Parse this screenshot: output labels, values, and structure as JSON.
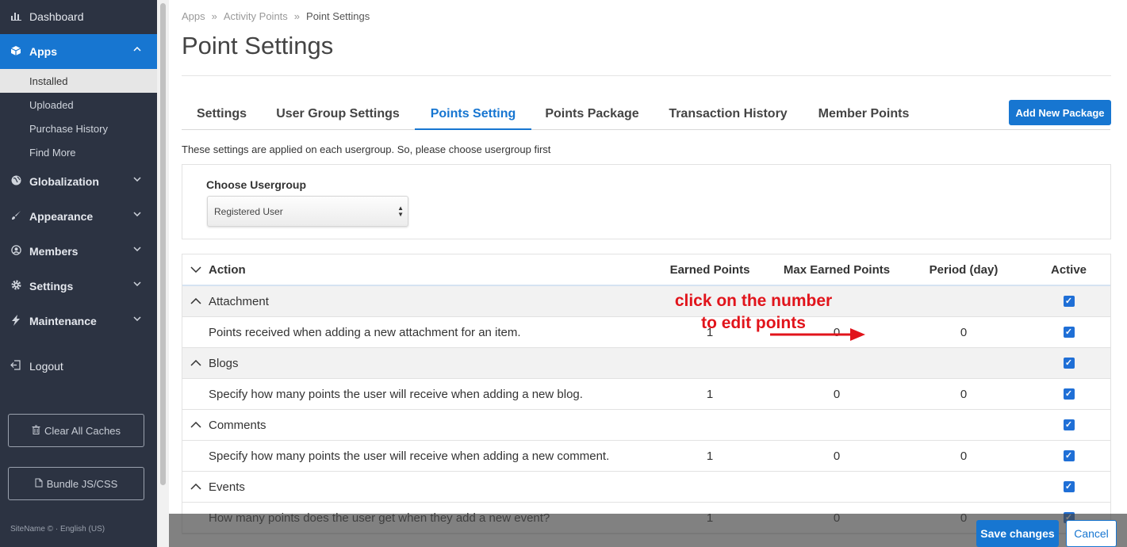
{
  "sidebar": {
    "items": [
      {
        "label": "Dashboard",
        "icon": "bar-chart-icon"
      },
      {
        "label": "Apps",
        "icon": "cube-icon"
      },
      {
        "label": "Globalization",
        "icon": "globe-icon"
      },
      {
        "label": "Appearance",
        "icon": "brush-icon"
      },
      {
        "label": "Members",
        "icon": "user-circle-icon"
      },
      {
        "label": "Settings",
        "icon": "gear-icon"
      },
      {
        "label": "Maintenance",
        "icon": "bolt-icon"
      },
      {
        "label": "Logout",
        "icon": "logout-icon"
      }
    ],
    "apps_subitems": [
      "Installed",
      "Uploaded",
      "Purchase History",
      "Find More"
    ],
    "clear_cache_label": "Clear All Caches",
    "bundle_label": "Bundle JS/CSS",
    "footer": "SiteName © · English (US)"
  },
  "breadcrumb": [
    "Apps",
    "Activity Points",
    "Point Settings"
  ],
  "page_title": "Point Settings",
  "tabs": [
    "Settings",
    "User Group Settings",
    "Points Setting",
    "Points Package",
    "Transaction History",
    "Member Points"
  ],
  "active_tab": "Points Setting",
  "add_button_label": "Add New Package",
  "description": "These settings are applied on each usergroup. So, please choose usergroup first",
  "usergroup": {
    "label": "Choose Usergroup",
    "selected": "Registered User"
  },
  "table": {
    "headers": {
      "action": "Action",
      "earned": "Earned Points",
      "max": "Max Earned Points",
      "period": "Period (day)",
      "active": "Active"
    },
    "groups": [
      {
        "name": "Attachment",
        "rows": [
          {
            "action": "Points received when adding a new attachment for an item.",
            "earned": "1",
            "max": "0",
            "period": "0"
          }
        ]
      },
      {
        "name": "Blogs",
        "rows": [
          {
            "action": "Specify how many points the user will receive when adding a new blog.",
            "earned": "1",
            "max": "0",
            "period": "0"
          }
        ]
      },
      {
        "name": "Comments",
        "rows": [
          {
            "action": "Specify how many points the user will receive when adding a new comment.",
            "earned": "1",
            "max": "0",
            "period": "0"
          }
        ]
      },
      {
        "name": "Events",
        "rows": [
          {
            "action": "How many points does the user get when they add a new event?",
            "earned": "1",
            "max": "0",
            "period": "0"
          }
        ]
      }
    ]
  },
  "annotation": {
    "line1": "click on the number",
    "line2": "to edit points"
  },
  "footer_actions": {
    "save": "Save changes",
    "cancel": "Cancel"
  },
  "colors": {
    "accent": "#1776d1",
    "sidebar_bg": "#2c3342",
    "annotation": "#e1141b"
  }
}
